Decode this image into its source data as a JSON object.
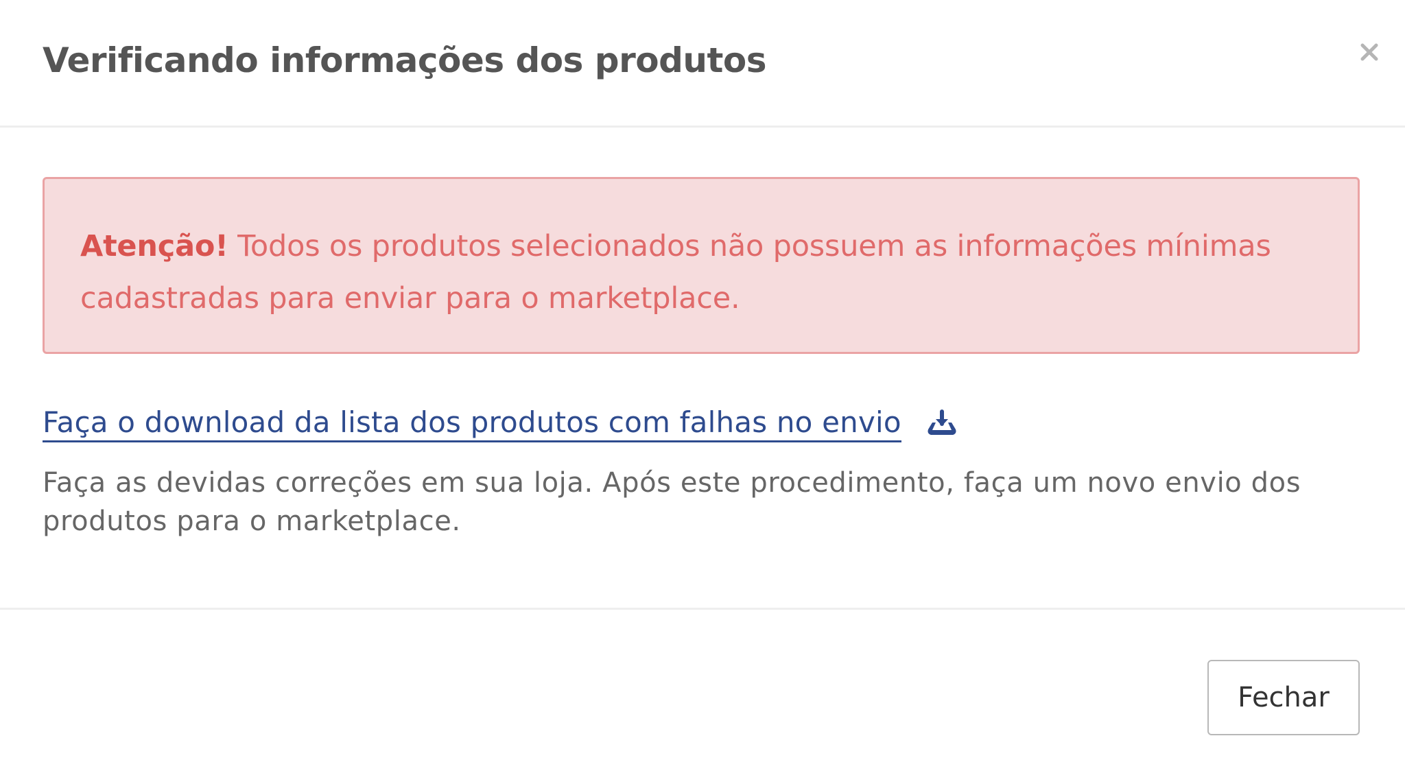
{
  "modal": {
    "title": "Verificando informações dos produtos",
    "close_icon": "close-icon"
  },
  "alert": {
    "label": "Atenção!",
    "message": " Todos os produtos selecionados não possuem as informações mínimas cadastradas para enviar para o marketplace."
  },
  "download": {
    "link_text": "Faça o download da lista dos produtos com falhas no envio",
    "icon": "download-icon"
  },
  "help_text": "Faça as devidas correções em sua loja. Após este procedimento, faça um novo envio dos produtos para o marketplace.",
  "footer": {
    "close_label": "Fechar"
  },
  "colors": {
    "title": "#555555",
    "alert_background": "#f6dcdd",
    "alert_border": "#eaa3a4",
    "alert_text": "#e06a6a",
    "alert_label": "#d9534f",
    "link": "#2e4b8e",
    "help_text": "#666666"
  }
}
